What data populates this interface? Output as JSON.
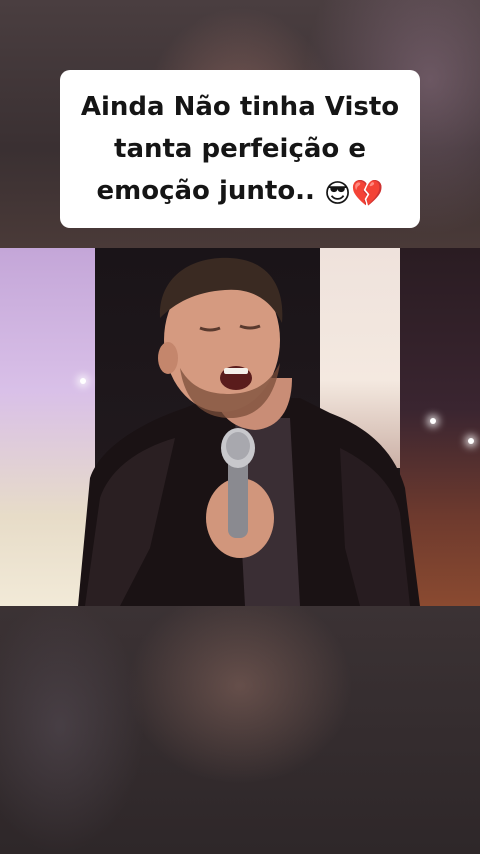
{
  "caption": {
    "line1": "Ainda Não tinha Visto",
    "line2": "tanta perfeição e",
    "line3": "emoção junto..",
    "emojis": [
      "😎",
      "💔"
    ]
  },
  "video": {
    "description_icon": "performer-video-icon"
  }
}
